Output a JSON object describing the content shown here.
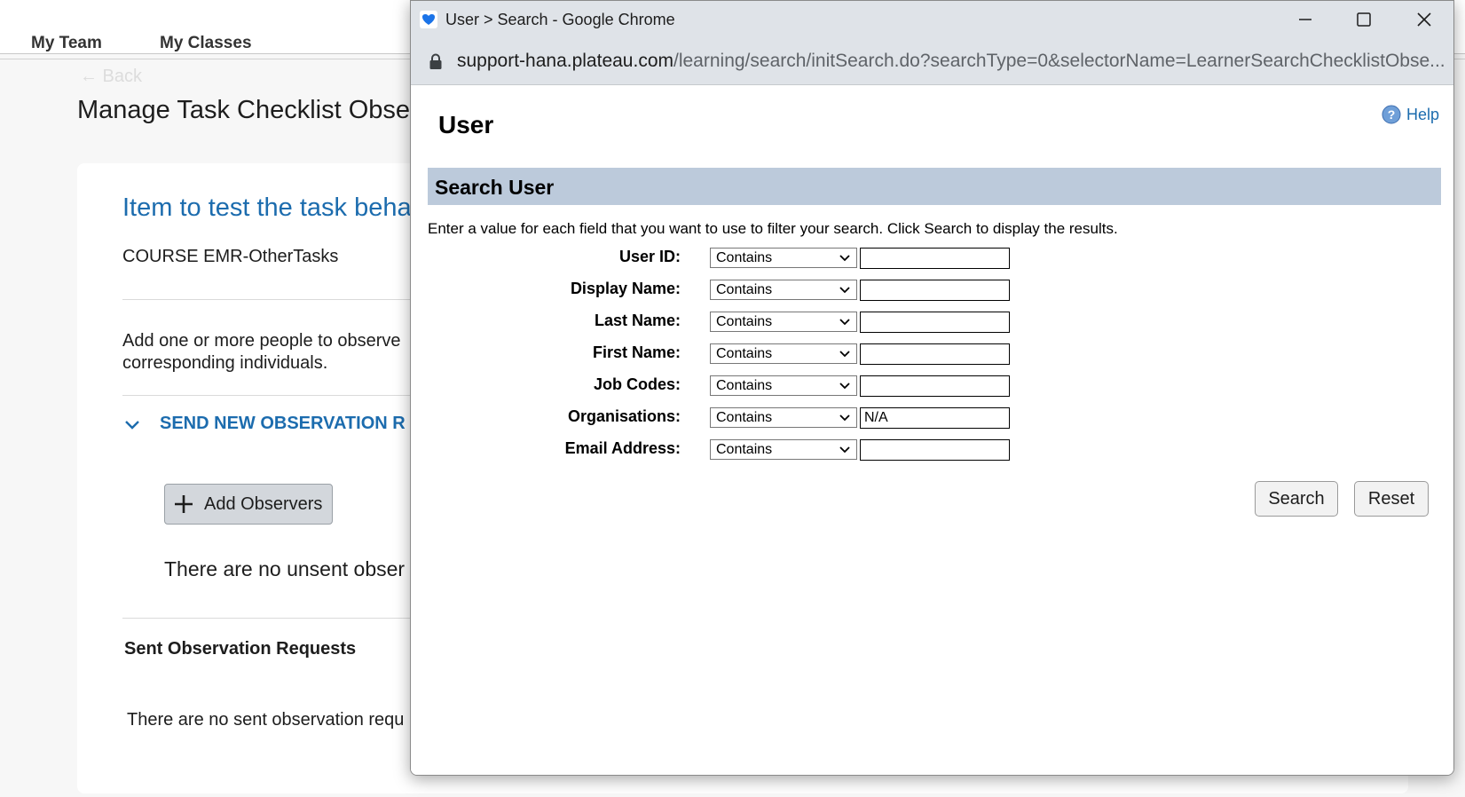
{
  "background": {
    "nav_tabs": [
      "My Team",
      "My Classes"
    ],
    "back_label": "← Back",
    "page_title": "Manage Task Checklist Obse",
    "item_title": "Item to test the task beha",
    "course": "COURSE EMR-OtherTasks",
    "description_line1": "Add one or more people to observe",
    "description_line2": "corresponding individuals.",
    "section_title": "SEND NEW OBSERVATION R",
    "add_observers_label": "Add Observers",
    "unsent_message": "There are no unsent obser",
    "sent_title": "Sent Observation Requests",
    "sent_message": "There are no sent observation requ"
  },
  "window": {
    "title": "User > Search - Google Chrome",
    "url_host": "support-hana.plateau.com",
    "url_path": "/learning/search/initSearch.do?searchType=0&selectorName=LearnerSearchChecklistObse..."
  },
  "dialog": {
    "heading": "User",
    "help_label": "Help",
    "section_title": "Search User",
    "instructions": "Enter a value for each field that you want to use to filter your search. Click Search to display the results.",
    "fields": [
      {
        "label": "User ID:",
        "operator": "Contains",
        "value": ""
      },
      {
        "label": "Display Name:",
        "operator": "Contains",
        "value": ""
      },
      {
        "label": "Last Name:",
        "operator": "Contains",
        "value": ""
      },
      {
        "label": "First Name:",
        "operator": "Contains",
        "value": ""
      },
      {
        "label": "Job Codes:",
        "operator": "Contains",
        "value": ""
      },
      {
        "label": "Organisations:",
        "operator": "Contains",
        "value": "N/A"
      },
      {
        "label": "Email Address:",
        "operator": "Contains",
        "value": ""
      }
    ],
    "search_label": "Search",
    "reset_label": "Reset"
  },
  "colors": {
    "accent_blue": "#1c6cae",
    "section_bar": "#bccadb",
    "chrome_frame": "#dfe3e8"
  }
}
